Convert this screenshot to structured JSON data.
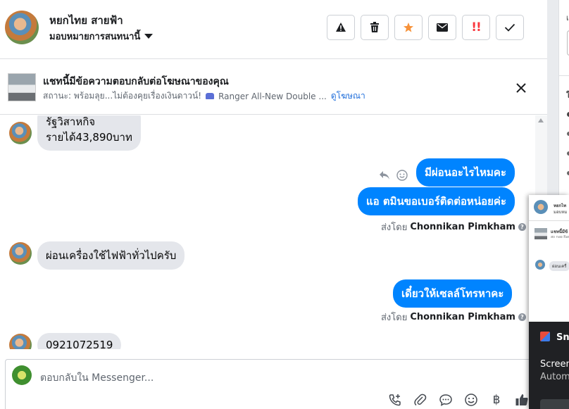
{
  "header": {
    "contact_name": "หยกไทย สายฟ้า",
    "assign_label": "มอบหมายการสนทนานี้",
    "actions": [
      "spam-warning",
      "delete",
      "star",
      "mark-unread",
      "important",
      "done"
    ]
  },
  "ad_bar": {
    "title": "แชทนี้มีข้อความตอบกลับต่อโฆษณาของคุณ",
    "status": "สถานะ: พร้อมลุย...ไม่ต้องคุยเรื่องเงินดาวน์!",
    "product": "Ranger All-New Double ...",
    "view_ad_link": "ดูโฆษณา"
  },
  "messages": [
    {
      "direction": "in",
      "lines": [
        "รัฐวิสาหกิจ",
        "รายได้43,890บาท"
      ]
    },
    {
      "direction": "out",
      "text": "มีผ่อนอะไรไหมคะ"
    },
    {
      "direction": "out",
      "text": "แอ ตมินขอเบอร์ติดต่อหน่อยค่ะ"
    },
    {
      "direction": "meta",
      "prefix": "ส่งโดย",
      "agent": "Chonnikan Pimkham"
    },
    {
      "direction": "in",
      "text": "ผ่อนเครื่องใช้ไฟฟ้าทั่วไปครับ"
    },
    {
      "direction": "out",
      "text": "เดี๋ยวให้เซลล์โทรหาคะ"
    },
    {
      "direction": "meta",
      "prefix": "ส่งโดย",
      "agent": "Chonnikan Pimkham"
    },
    {
      "direction": "in",
      "text": "0921072519"
    }
  ],
  "composer": {
    "placeholder": "ตอบกลับใน Messenger...",
    "icons": [
      "add-call-icon",
      "attachment-icon",
      "saved-reply-icon",
      "emoji-icon",
      "payment-icon",
      "like-icon"
    ],
    "payment_symbol": "฿"
  },
  "right_pane": {
    "glyphs": [
      "เ",
      "ใ"
    ]
  },
  "floating_preview": {
    "row1_name": "หยกไท",
    "row1_sub": "มอบหม",
    "row2_title": "แชทนี้มีข้",
    "row2_sub": "สถ กอย Ran",
    "row3_text": "ผ่อนเครื่"
  },
  "snip_panel": {
    "title": "Snip",
    "line1": "Screen",
    "line2": "Autom"
  },
  "colors": {
    "accent": "#0084ff",
    "incoming_bubble": "#e4e6eb",
    "star": "#f7923a",
    "important": "#fa383e",
    "link": "#216fdb"
  }
}
